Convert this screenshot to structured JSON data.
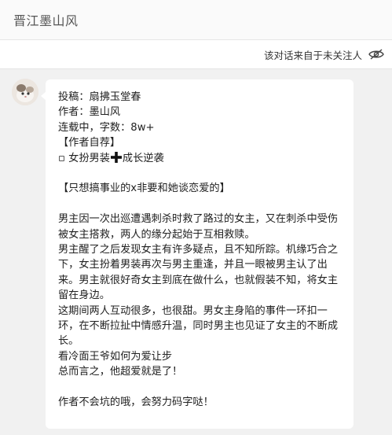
{
  "header": {
    "title": "晋江墨山风"
  },
  "notice": {
    "text": "该对话来自于未关注人",
    "icon": "eye-hidden-icon"
  },
  "message": {
    "avatar_icon": "user-avatar",
    "lines": [
      "投稿：扇拂玉堂春",
      "作者：墨山风",
      "连载中，字数：8w+",
      "【作者自荐】"
    ],
    "tag_prefix": "▫ 女扮男装",
    "tag_suffix": "成长逆袭",
    "tag_icon": "plus-cross-icon",
    "theme": "【只想搞事业的x非要和她谈恋爱的】",
    "paragraphs": [
      "男主因一次出巡遭遇刺杀时救了路过的女主，又在刺杀中受伤被女主搭救，两人的缘分起始于互相救赎。",
      "男主醒了之后发现女主有许多疑点，且不知所踪。机缘巧合之下，女主扮着男装再次与男主重逢，并且一眼被男主认了出来。男主就很好奇女主到底在做什么，也就假装不知，将女主留在身边。",
      "这期间两人互动很多，也很甜。男女主身陷的事件一环扣一环，在不断拉扯中情感升温，同时男主也见证了女主的不断成长。",
      "看冷面王爷如何为爱让步",
      "总而言之，他超爱就是了！"
    ],
    "closing": "作者不会坑的哦，会努力码字哒！"
  }
}
